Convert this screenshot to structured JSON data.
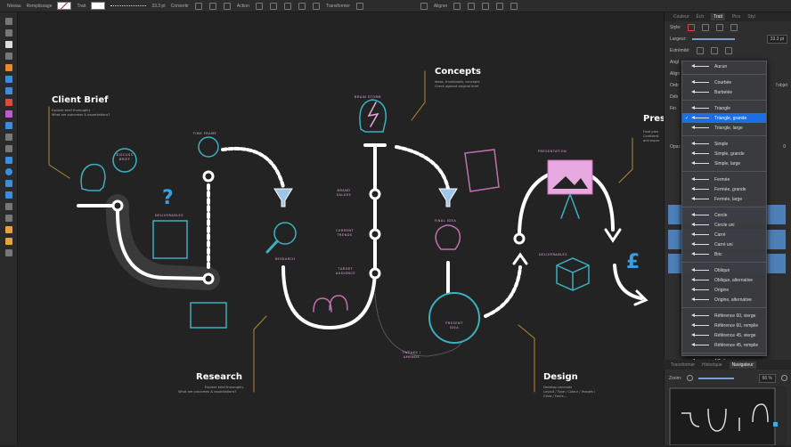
{
  "toolbar": {
    "stroke_label": "Niveau",
    "fill_label": "Remplissage",
    "trait_label": "Trait",
    "width_value": "33.3 pt",
    "convert_label": "Convertir",
    "action_label": "Action",
    "transform_label": "Transformer",
    "align_label": "Aligner"
  },
  "panel": {
    "tabs": [
      "Couleur",
      "Éch",
      "Trait",
      "Pics",
      "Styl"
    ],
    "active_tab": "Trait",
    "style_label": "Style:",
    "width_label": "Largeur:",
    "width_value": "33.3 pt",
    "ends_label": "Extrémité:",
    "angle_label": "Angl",
    "align_label": "Align",
    "order_label": "Ordr",
    "start_label": "Déb",
    "end_label": "Fin",
    "object_label": "l'objet",
    "opacity_label": "Opac",
    "zero": "0"
  },
  "arrow_menu": {
    "items": [
      {
        "label": "Aucun"
      },
      {
        "sep": true
      },
      {
        "label": "Courbée"
      },
      {
        "label": "Barbelée"
      },
      {
        "sep": true
      },
      {
        "label": "Triangle"
      },
      {
        "label": "Triangle, grande",
        "selected": true
      },
      {
        "label": "Triangle, large"
      },
      {
        "sep": true
      },
      {
        "label": "Simple"
      },
      {
        "label": "Simple, grande"
      },
      {
        "label": "Simple, large"
      },
      {
        "sep": true
      },
      {
        "label": "Fermée"
      },
      {
        "label": "Fermée, grande"
      },
      {
        "label": "Fermée, large"
      },
      {
        "sep": true
      },
      {
        "label": "Cercle"
      },
      {
        "label": "Cercle uni"
      },
      {
        "label": "Carré"
      },
      {
        "label": "Carré uni"
      },
      {
        "label": "Bric"
      },
      {
        "sep": true
      },
      {
        "label": "Oblique"
      },
      {
        "label": "Oblique, alternative"
      },
      {
        "label": "Origine"
      },
      {
        "label": "Origine, alternative"
      },
      {
        "sep": true
      },
      {
        "label": "Référence 60, vierge"
      },
      {
        "label": "Référence 60, remplie"
      },
      {
        "label": "Référence 45, vierge"
      },
      {
        "label": "Référence 45, remplie"
      },
      {
        "sep": true
      },
      {
        "label": "Affinity"
      }
    ]
  },
  "navigator": {
    "tabs": [
      "Transformer",
      "Historique",
      "Navigateur"
    ],
    "active": "Navigateur",
    "zoom_label": "Zoom:",
    "zoom_value": "66 %"
  },
  "canvas": {
    "client_brief": {
      "title": "Client Brief",
      "lines": [
        "Explore brief thoroughly",
        "What are outcomes & expectations?"
      ]
    },
    "concepts": {
      "title": "Concepts",
      "lines": [
        "Ideas, thumbnails, concepts",
        "Check against original brief"
      ]
    },
    "research": {
      "title": "Research",
      "lines": [
        "Explore brief thoroughly",
        "What are outcomes & expectations?"
      ]
    },
    "design": {
      "title": "Design",
      "lines": [
        "Develop concepts",
        "Layout / Type / Colour / Images /",
        "Grids / Fonts..."
      ]
    },
    "presentation": {
      "title": "Pres",
      "lines": [
        "Final pres",
        "Confident",
        "and expec"
      ]
    },
    "labels": {
      "discuss": "DISCUSS BRIEF",
      "time": "TIME FRAME",
      "deliverables": "DELIVERABLES",
      "research": "RESEARCH",
      "brain": "BRAIN STORM",
      "brand": "BRAND VALUES",
      "trends": "CURRENT TRENDS",
      "audience": "TARGET AUDIENCE",
      "final": "FINAL IDEA",
      "present": "PRESENT IDEA",
      "tweaks": "TWEAKS / AMENDS",
      "presentation": "PRESENTATION",
      "deliverables2": "DELIVERABLES",
      "question": "?",
      "pound": "£"
    }
  }
}
